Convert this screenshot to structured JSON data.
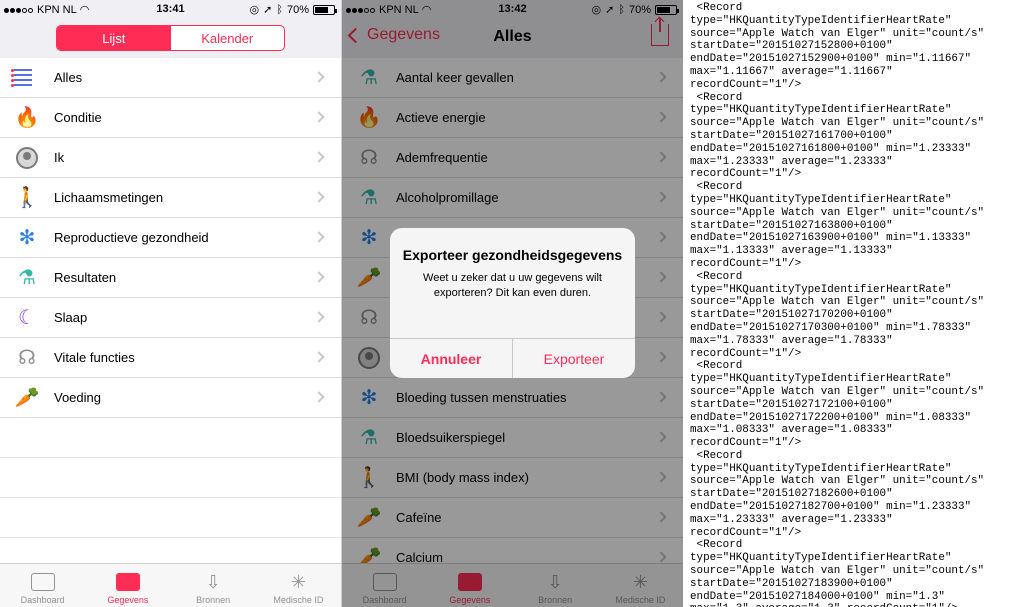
{
  "screens": [
    {
      "status": {
        "carrier": "KPN NL",
        "time": "13:41",
        "battery": "70%",
        "battery_level": 0.7
      },
      "segmented": {
        "left": "Lijst",
        "right": "Kalender"
      },
      "items": [
        {
          "label": "Alles",
          "icon": "list-icon"
        },
        {
          "label": "Conditie",
          "icon": "flame-icon"
        },
        {
          "label": "Ik",
          "icon": "person-icon"
        },
        {
          "label": "Lichaamsmetingen",
          "icon": "body-icon"
        },
        {
          "label": "Reproductieve gezondheid",
          "icon": "snowflake-icon"
        },
        {
          "label": "Resultaten",
          "icon": "flask-icon"
        },
        {
          "label": "Slaap",
          "icon": "moon-icon"
        },
        {
          "label": "Vitale functies",
          "icon": "stethoscope-icon"
        },
        {
          "label": "Voeding",
          "icon": "carrot-icon"
        }
      ],
      "tabs": [
        {
          "label": "Dashboard",
          "icon": "dashboard-icon"
        },
        {
          "label": "Gegevens",
          "icon": "heart-folder-icon",
          "active": true
        },
        {
          "label": "Bronnen",
          "icon": "download-heart-icon"
        },
        {
          "label": "Medische ID",
          "icon": "asterisk-icon"
        }
      ]
    },
    {
      "status": {
        "carrier": "KPN NL",
        "time": "13:42",
        "battery": "70%",
        "battery_level": 0.7
      },
      "nav": {
        "back": "Gegevens",
        "title": "Alles"
      },
      "items": [
        {
          "label": "Aantal keer gevallen",
          "icon": "flask-icon"
        },
        {
          "label": "Actieve energie",
          "icon": "flame-icon"
        },
        {
          "label": "Ademfrequentie",
          "icon": "stethoscope-icon"
        },
        {
          "label": "Alcoholpromillage",
          "icon": "flask-icon"
        },
        {
          "label": "",
          "icon": "snowflake-icon"
        },
        {
          "label": "",
          "icon": "carrot-icon"
        },
        {
          "label": "",
          "icon": "stethoscope-icon"
        },
        {
          "label": "",
          "icon": "person-icon"
        },
        {
          "label": "Bloeding tussen menstruaties",
          "icon": "snowflake-icon"
        },
        {
          "label": "Bloedsuikerspiegel",
          "icon": "flask-icon"
        },
        {
          "label": "BMI (body mass index)",
          "icon": "body-icon"
        },
        {
          "label": "Cafeïne",
          "icon": "carrot-icon"
        },
        {
          "label": "Calcium",
          "icon": "carrot-icon"
        }
      ],
      "dialog": {
        "title": "Exporteer gezondheidsgegevens",
        "message": "Weet u zeker dat u uw gegevens wilt exporteren? Dit kan even duren.",
        "cancel": "Annuleer",
        "confirm": "Exporteer"
      },
      "tabs": [
        {
          "label": "Dashboard",
          "icon": "dashboard-icon"
        },
        {
          "label": "Gegevens",
          "icon": "heart-folder-icon",
          "active": true
        },
        {
          "label": "Bronnen",
          "icon": "download-heart-icon"
        },
        {
          "label": "Medische ID",
          "icon": "asterisk-icon"
        }
      ]
    }
  ],
  "xml_text": " <Record\ntype=\"HKQuantityTypeIdentifierHeartRate\"\nsource=\"Apple Watch van Elger\" unit=\"count/s\"\nstartDate=\"20151027152800+0100\"\nendDate=\"20151027152900+0100\" min=\"1.11667\"\nmax=\"1.11667\" average=\"1.11667\"\nrecordCount=\"1\"/>\n <Record\ntype=\"HKQuantityTypeIdentifierHeartRate\"\nsource=\"Apple Watch van Elger\" unit=\"count/s\"\nstartDate=\"20151027161700+0100\"\nendDate=\"20151027161800+0100\" min=\"1.23333\"\nmax=\"1.23333\" average=\"1.23333\"\nrecordCount=\"1\"/>\n <Record\ntype=\"HKQuantityTypeIdentifierHeartRate\"\nsource=\"Apple Watch van Elger\" unit=\"count/s\"\nstartDate=\"20151027163800+0100\"\nendDate=\"20151027163900+0100\" min=\"1.13333\"\nmax=\"1.13333\" average=\"1.13333\"\nrecordCount=\"1\"/>\n <Record\ntype=\"HKQuantityTypeIdentifierHeartRate\"\nsource=\"Apple Watch van Elger\" unit=\"count/s\"\nstartDate=\"20151027170200+0100\"\nendDate=\"20151027170300+0100\" min=\"1.78333\"\nmax=\"1.78333\" average=\"1.78333\"\nrecordCount=\"1\"/>\n <Record\ntype=\"HKQuantityTypeIdentifierHeartRate\"\nsource=\"Apple Watch van Elger\" unit=\"count/s\"\nstartDate=\"20151027172100+0100\"\nendDate=\"20151027172200+0100\" min=\"1.08333\"\nmax=\"1.08333\" average=\"1.08333\"\nrecordCount=\"1\"/>\n <Record\ntype=\"HKQuantityTypeIdentifierHeartRate\"\nsource=\"Apple Watch van Elger\" unit=\"count/s\"\nstartDate=\"20151027182600+0100\"\nendDate=\"20151027182700+0100\" min=\"1.23333\"\nmax=\"1.23333\" average=\"1.23333\"\nrecordCount=\"1\"/>\n <Record\ntype=\"HKQuantityTypeIdentifierHeartRate\"\nsource=\"Apple Watch van Elger\" unit=\"count/s\"\nstartDate=\"20151027183900+0100\"\nendDate=\"20151027184000+0100\" min=\"1.3\"\nmax=\"1.3\" average=\"1.3\" recordCount=\"1\"/>",
  "colors": {
    "accent": "#ff2d55",
    "separator": "#dcdce0",
    "chevron": "#c7c7cc",
    "tab_inactive": "#929292"
  }
}
